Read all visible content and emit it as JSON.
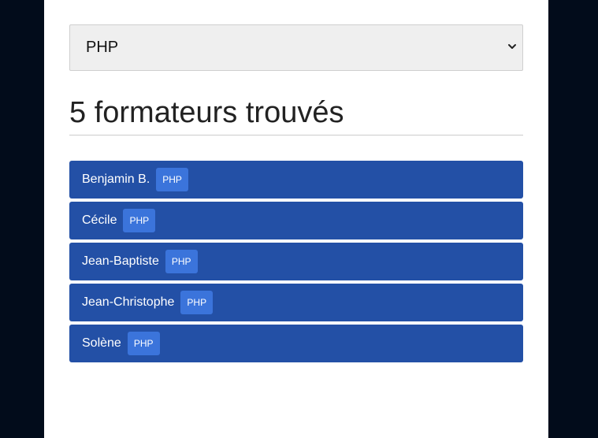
{
  "filter": {
    "selected": "PHP"
  },
  "heading": "5 formateurs trouvés",
  "trainers": [
    {
      "name": "Benjamin B.",
      "tag": "PHP"
    },
    {
      "name": "Cécile",
      "tag": "PHP"
    },
    {
      "name": "Jean-Baptiste",
      "tag": "PHP"
    },
    {
      "name": "Jean-Christophe",
      "tag": "PHP"
    },
    {
      "name": "Solène",
      "tag": "PHP"
    }
  ],
  "colors": {
    "item_bg": "#2350a6",
    "badge_bg": "#3b74db",
    "outer_bg": "#020c1b"
  }
}
